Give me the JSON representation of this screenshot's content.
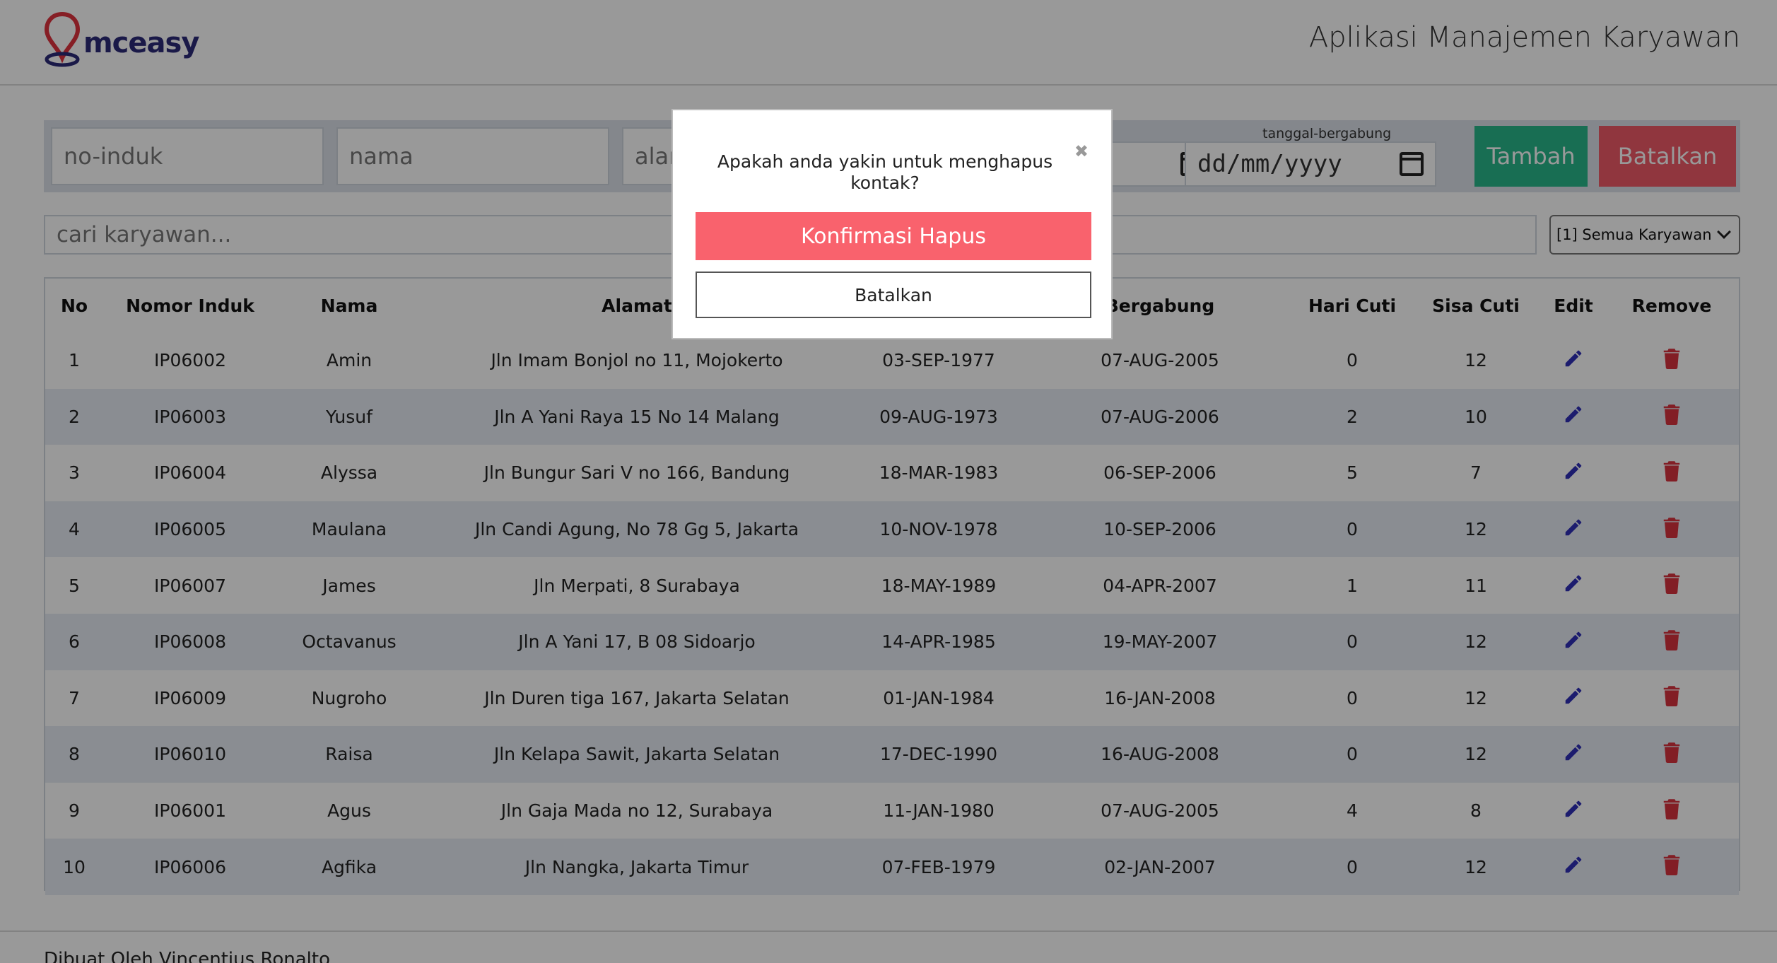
{
  "header": {
    "logo_text": "mceasy",
    "app_title": "Aplikasi Manajemen Karyawan"
  },
  "form": {
    "no_induk_placeholder": "no-induk",
    "nama_placeholder": "nama",
    "alamat_placeholder": "alar",
    "date_label": "tanggal-bergabung",
    "date_placeholder": "dd/mm/yyyy",
    "tambah_label": "Tambah",
    "batalkan_label": "Batalkan"
  },
  "search": {
    "placeholder": "cari karyawan...",
    "filter_selected": "[1] Semua Karyawan"
  },
  "table": {
    "headers": [
      "No",
      "Nomor Induk",
      "Nama",
      "Alamat",
      "",
      "Bergabung",
      "Hari Cuti",
      "Sisa Cuti",
      "Edit",
      "Remove"
    ],
    "rows": [
      [
        "1",
        "IP06002",
        "Amin",
        "Jln Imam Bonjol no 11, Mojokerto",
        "03-SEP-1977",
        "07-AUG-2005",
        "0",
        "12"
      ],
      [
        "2",
        "IP06003",
        "Yusuf",
        "Jln A Yani Raya 15 No 14 Malang",
        "09-AUG-1973",
        "07-AUG-2006",
        "2",
        "10"
      ],
      [
        "3",
        "IP06004",
        "Alyssa",
        "Jln Bungur Sari V no 166, Bandung",
        "18-MAR-1983",
        "06-SEP-2006",
        "5",
        "7"
      ],
      [
        "4",
        "IP06005",
        "Maulana",
        "Jln Candi Agung, No 78 Gg 5, Jakarta",
        "10-NOV-1978",
        "10-SEP-2006",
        "0",
        "12"
      ],
      [
        "5",
        "IP06007",
        "James",
        "Jln Merpati, 8 Surabaya",
        "18-MAY-1989",
        "04-APR-2007",
        "1",
        "11"
      ],
      [
        "6",
        "IP06008",
        "Octavanus",
        "Jln A Yani 17, B 08 Sidoarjo",
        "14-APR-1985",
        "19-MAY-2007",
        "0",
        "12"
      ],
      [
        "7",
        "IP06009",
        "Nugroho",
        "Jln Duren tiga 167, Jakarta Selatan",
        "01-JAN-1984",
        "16-JAN-2008",
        "0",
        "12"
      ],
      [
        "8",
        "IP06010",
        "Raisa",
        "Jln Kelapa Sawit, Jakarta Selatan",
        "17-DEC-1990",
        "16-AUG-2008",
        "0",
        "12"
      ],
      [
        "9",
        "IP06001",
        "Agus",
        "Jln Gaja Mada no 12, Surabaya",
        "11-JAN-1980",
        "07-AUG-2005",
        "4",
        "8"
      ],
      [
        "10",
        "IP06006",
        "Agfika",
        "Jln Nangka, Jakarta Timur",
        "07-FEB-1979",
        "02-JAN-2007",
        "0",
        "12"
      ]
    ]
  },
  "footer": {
    "text": "Dibuat Oleh Vincentius Ronalto"
  },
  "modal": {
    "message": "Apakah anda yakin untuk menghapus kontak?",
    "close_glyph": "✖",
    "confirm_label": "Konfirmasi Hapus",
    "cancel_label": "Batalkan"
  },
  "colors": {
    "brand": "#2c2a78",
    "logo_pin": "#e0333f",
    "tambah": "#29b78a",
    "batalkan": "#f05a68",
    "confirm": "#f9626d",
    "edit_icon": "#2f2fb8",
    "remove_icon": "#d9323f"
  },
  "icons": {
    "edit": "pencil-icon",
    "remove": "trash-icon",
    "date": "calendar-icon",
    "close": "close-icon"
  }
}
